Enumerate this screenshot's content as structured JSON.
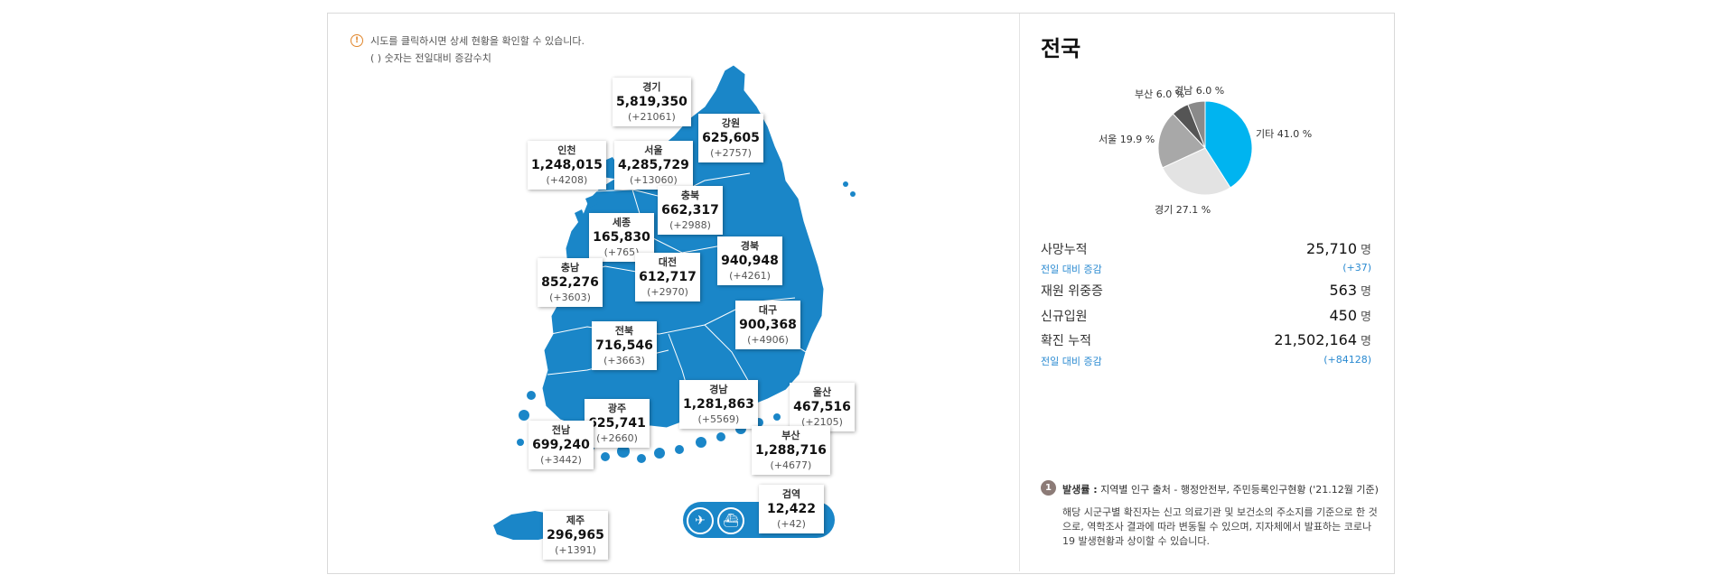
{
  "notice": {
    "icon": "info-icon",
    "line1": "시도를 클릭하시면 상세 현황을 확인할 수 있습니다.",
    "line2": "( ) 숫자는 전일대비 증감수치"
  },
  "colors": {
    "map_blue": "#1a86c8",
    "accent_blue": "#2a8ad1",
    "pie_other": "#00b4f0"
  },
  "regions": [
    {
      "name": "경기",
      "count": "5,819,350",
      "delta": "(+21061)"
    },
    {
      "name": "강원",
      "count": "625,605",
      "delta": "(+2757)"
    },
    {
      "name": "인천",
      "count": "1,248,015",
      "delta": "(+4208)"
    },
    {
      "name": "서울",
      "count": "4,285,729",
      "delta": "(+13060)"
    },
    {
      "name": "충북",
      "count": "662,317",
      "delta": "(+2988)"
    },
    {
      "name": "세종",
      "count": "165,830",
      "delta": "(+765)"
    },
    {
      "name": "경북",
      "count": "940,948",
      "delta": "(+4261)"
    },
    {
      "name": "충남",
      "count": "852,276",
      "delta": "(+3603)"
    },
    {
      "name": "대전",
      "count": "612,717",
      "delta": "(+2970)"
    },
    {
      "name": "대구",
      "count": "900,368",
      "delta": "(+4906)"
    },
    {
      "name": "전북",
      "count": "716,546",
      "delta": "(+3663)"
    },
    {
      "name": "울산",
      "count": "467,516",
      "delta": "(+2105)"
    },
    {
      "name": "경남",
      "count": "1,281,863",
      "delta": "(+5569)"
    },
    {
      "name": "광주",
      "count": "625,741",
      "delta": "(+2660)"
    },
    {
      "name": "부산",
      "count": "1,288,716",
      "delta": "(+4677)"
    },
    {
      "name": "전남",
      "count": "699,240",
      "delta": "(+3442)"
    },
    {
      "name": "검역",
      "count": "12,422",
      "delta": "(+42)"
    },
    {
      "name": "제주",
      "count": "296,965",
      "delta": "(+1391)"
    }
  ],
  "port_icons": [
    "airplane-icon",
    "ship-icon"
  ],
  "national": {
    "title": "전국",
    "chart_data": {
      "type": "pie",
      "categories": [
        "기타",
        "경기",
        "서울",
        "부산",
        "경남"
      ],
      "values": [
        41.0,
        27.1,
        19.9,
        6.0,
        6.0
      ],
      "labels": [
        "기타 41.0 %",
        "경기 27.1 %",
        "서울 19.9 %",
        "부산 6.0 %",
        "경남 6.0 %"
      ],
      "colors": [
        "#00b4f0",
        "#e3e3e3",
        "#a8a8a8",
        "#555555",
        "#8a8a8a"
      ]
    },
    "stats": {
      "deaths_label": "사망누적",
      "deaths_value": "25,710",
      "deaths_unit": "명",
      "deaths_delta_label": "전일 대비 증감",
      "deaths_delta_value": "(+37)",
      "severe_label": "재원 위중증",
      "severe_value": "563",
      "severe_unit": "명",
      "admit_label": "신규입원",
      "admit_value": "450",
      "admit_unit": "명",
      "confirmed_label": "확진 누적",
      "confirmed_value": "21,502,164",
      "confirmed_unit": "명",
      "confirmed_delta_label": "전일 대비 증감",
      "confirmed_delta_value": "(+84128)"
    }
  },
  "footnote": {
    "num": "1",
    "head_bold": "발생률 :",
    "head_rest": " 지역별 인구 출처 - 행정안전부, 주민등록인구현황 ('21.12월 기준)",
    "body": "해당 시군구별 확진자는 신고 의료기관 및 보건소의 주소지를 기준으로 한 것으로, 역학조사 결과에 따라 변동될 수 있으며, 지자체에서 발표하는 코로나19 발생현황과 상이할 수 있습니다."
  }
}
